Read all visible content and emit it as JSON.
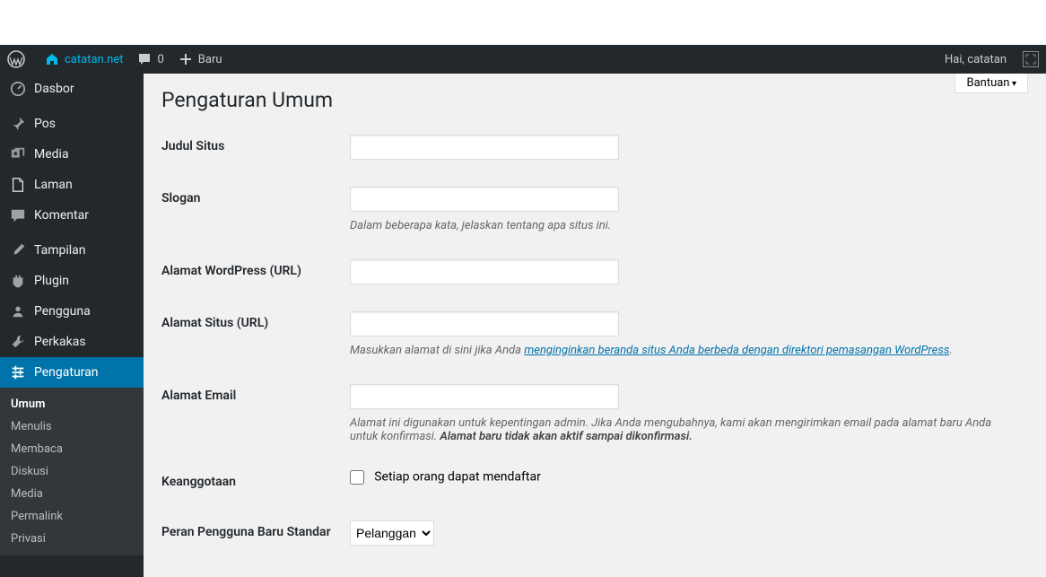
{
  "adminbar": {
    "site_name": "catatan.net",
    "comments_count": "0",
    "new_label": "Baru",
    "greeting": "Hai, catatan"
  },
  "sidebar": {
    "items": [
      {
        "label": "Dasbor",
        "icon": "dashboard"
      },
      {
        "label": "Pos",
        "icon": "pin"
      },
      {
        "label": "Media",
        "icon": "media"
      },
      {
        "label": "Laman",
        "icon": "page"
      },
      {
        "label": "Komentar",
        "icon": "comment"
      },
      {
        "label": "Tampilan",
        "icon": "appearance"
      },
      {
        "label": "Plugin",
        "icon": "plugin"
      },
      {
        "label": "Pengguna",
        "icon": "users"
      },
      {
        "label": "Perkakas",
        "icon": "tools"
      },
      {
        "label": "Pengaturan",
        "icon": "settings"
      }
    ],
    "submenu": {
      "items": [
        "Umum",
        "Menulis",
        "Membaca",
        "Diskusi",
        "Media",
        "Permalink",
        "Privasi"
      ],
      "current": "Umum"
    }
  },
  "content": {
    "help_label": "Bantuan",
    "page_title": "Pengaturan Umum",
    "fields": {
      "site_title_label": "Judul Situs",
      "tagline_label": "Slogan",
      "tagline_desc": "Dalam beberapa kata, jelaskan tentang apa situs ini.",
      "wp_url_label": "Alamat WordPress (URL)",
      "site_url_label": "Alamat Situs (URL)",
      "site_url_desc_prefix": "Masukkan alamat di sini jika Anda ",
      "site_url_desc_link": "menginginkan beranda situs Anda berbeda dengan direktori pemasangan WordPress",
      "email_label": "Alamat Email",
      "email_desc_1": "Alamat ini digunakan untuk kepentingan admin. Jika Anda mengubahnya, kami akan mengirimkan email pada alamat baru Anda untuk konfirmasi. ",
      "email_desc_2": "Alamat baru tidak akan aktif sampai dikonfirmasi.",
      "membership_label": "Keanggotaan",
      "membership_checkbox": "Setiap orang dapat mendaftar",
      "role_label": "Peran Pengguna Baru Standar",
      "role_value": "Pelanggan"
    }
  }
}
